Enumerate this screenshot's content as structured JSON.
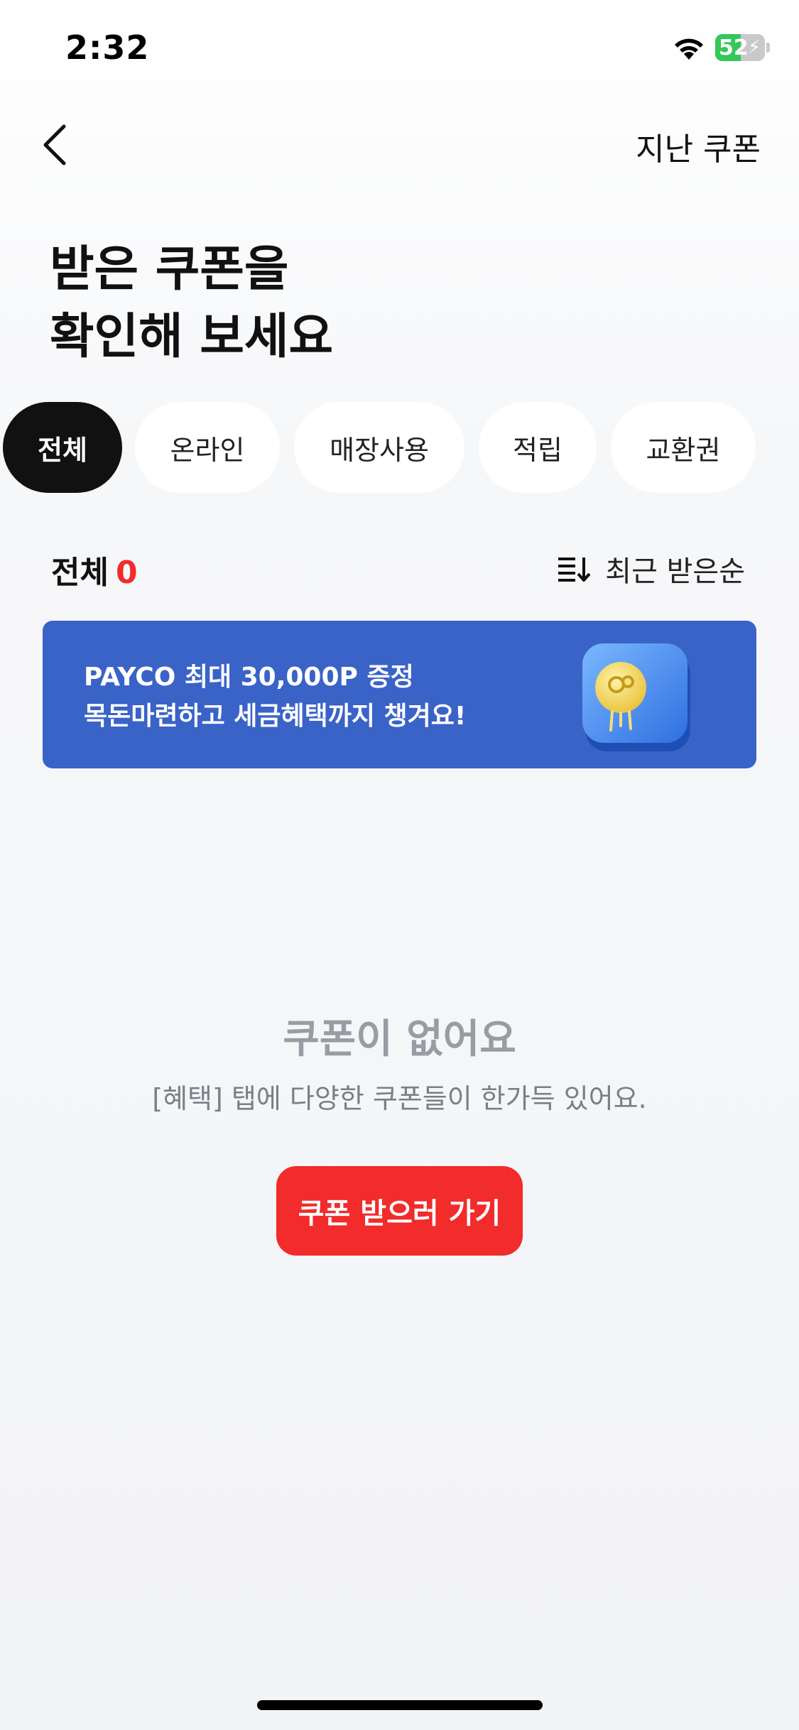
{
  "status_bar": {
    "time": "2:32",
    "battery_percent": "52",
    "battery_level": 0.52
  },
  "header": {
    "past_coupons_label": "지난 쿠폰"
  },
  "title": {
    "line1": "받은 쿠폰을",
    "line2": "확인해 보세요"
  },
  "tabs": [
    {
      "label": "전체",
      "active": true
    },
    {
      "label": "온라인"
    },
    {
      "label": "매장사용"
    },
    {
      "label": "적립"
    },
    {
      "label": "교환권"
    }
  ],
  "summary": {
    "label": "전체",
    "count": "0",
    "sort_label": "최근 받은순"
  },
  "banner": {
    "line1": "PAYCO 최대 30,000P 증정",
    "line2": "목돈마련하고 세금혜택까지 챙겨요!",
    "bg_color": "#3a63c8"
  },
  "empty_state": {
    "title": "쿠폰이 없어요",
    "subtitle": "[혜택] 탭에 다양한 쿠폰들이 한가득 있어요.",
    "button_label": "쿠폰 받으러 가기"
  },
  "colors": {
    "accent_red": "#f22b2b",
    "active_tab": "#111111"
  }
}
